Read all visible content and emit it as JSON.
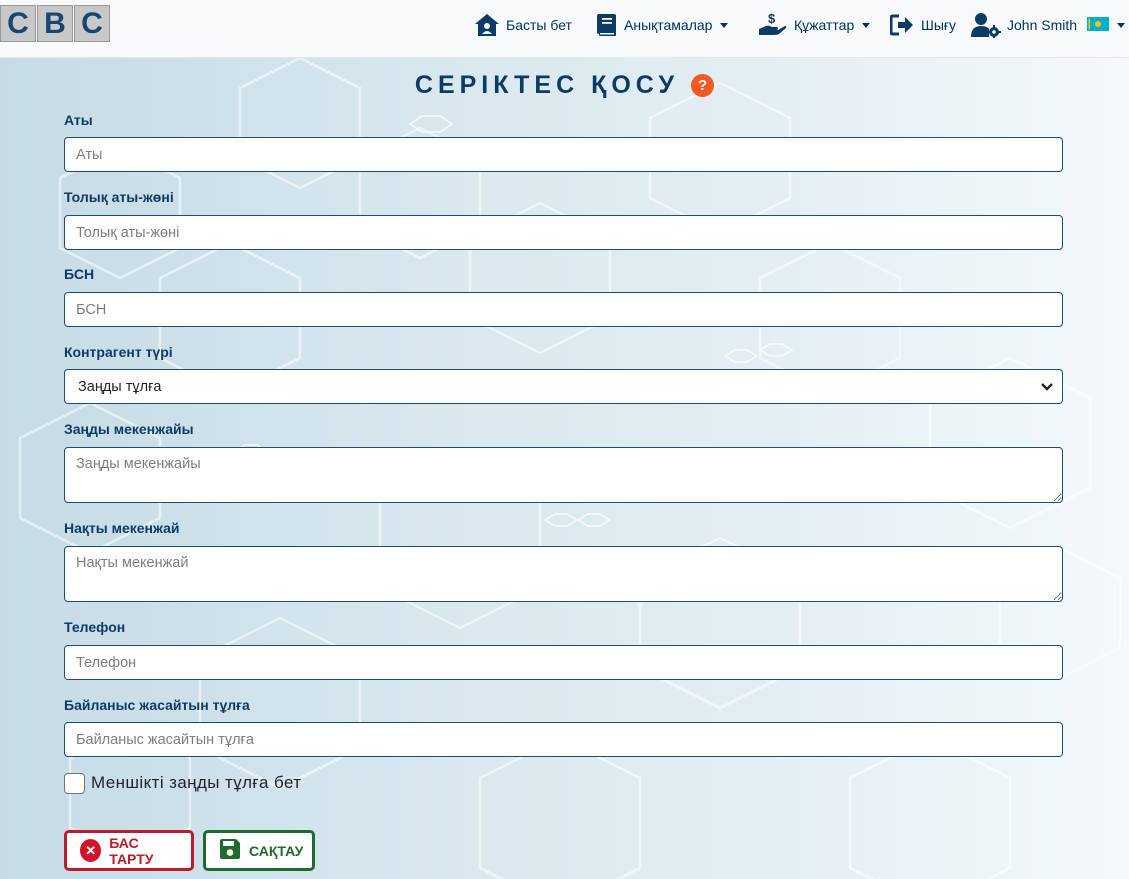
{
  "brand": {
    "letters": [
      "C",
      "B",
      "C"
    ]
  },
  "nav": {
    "home": "Басты бет",
    "references": "Анықтамалар",
    "documents": "Құжаттар",
    "logout": "Шығу",
    "user": "John Smith"
  },
  "page": {
    "title": "СЕРІКТЕС ҚОСУ",
    "help": "?"
  },
  "form": {
    "name": {
      "label": "Аты",
      "placeholder": "Аты",
      "value": ""
    },
    "full_name": {
      "label": "Толық аты-жөні",
      "placeholder": "Толық аты-жөні",
      "value": ""
    },
    "bin": {
      "label": "БСН",
      "placeholder": "БСН",
      "value": ""
    },
    "counterparty_type": {
      "label": "Контрагент түрі",
      "selected": "Заңды тұлға"
    },
    "legal_address": {
      "label": "Заңды мекенжайы",
      "placeholder": "Заңды мекенжайы",
      "value": ""
    },
    "actual_address": {
      "label": "Нақты мекенжай",
      "placeholder": "Нақты мекенжай",
      "value": ""
    },
    "phone": {
      "label": "Телефон",
      "placeholder": "Телефон",
      "value": ""
    },
    "contact_person": {
      "label": "Байланыс жасайтын тұлға",
      "placeholder": "Байланыс жасайтын тұлға",
      "value": ""
    },
    "own_entity": {
      "label": "Меншікті заңды тұлға бет",
      "checked": false
    }
  },
  "buttons": {
    "cancel": "БАС ТАРТУ",
    "save": "САҚТАУ"
  },
  "icons": {
    "home": "home-icon",
    "references": "book-icon",
    "documents": "hand-dollar-icon",
    "logout": "sign-out-icon",
    "user": "user-cog-icon",
    "flag": "kazakhstan-flag-icon",
    "cancel": "times-circle-icon",
    "save": "floppy-disk-icon"
  },
  "colors": {
    "primary": "#0d3b66",
    "accent": "#f15a24",
    "cancel": "#bd1b2b",
    "save": "#1f6a2c",
    "flag": "#00afca"
  }
}
